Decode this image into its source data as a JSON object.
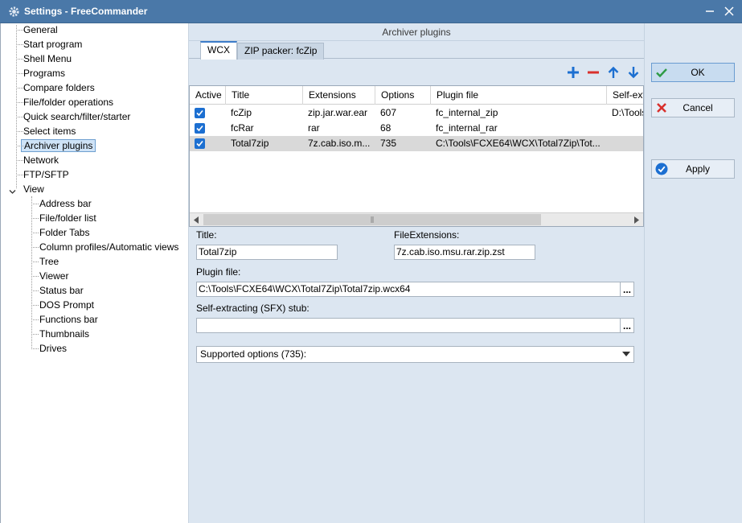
{
  "window": {
    "title": "Settings - FreeCommander"
  },
  "tree": {
    "items": [
      {
        "label": "General",
        "level": 1
      },
      {
        "label": "Start program",
        "level": 1
      },
      {
        "label": "Shell Menu",
        "level": 1
      },
      {
        "label": "Programs",
        "level": 1
      },
      {
        "label": "Compare folders",
        "level": 1
      },
      {
        "label": "File/folder operations",
        "level": 1
      },
      {
        "label": "Quick search/filter/starter",
        "level": 1
      },
      {
        "label": "Select items",
        "level": 1
      },
      {
        "label": "Archiver plugins",
        "level": 1,
        "selected": true
      },
      {
        "label": "Network",
        "level": 1
      },
      {
        "label": "FTP/SFTP",
        "level": 1
      },
      {
        "label": "View",
        "level": 1,
        "expanded": true
      },
      {
        "label": "Address bar",
        "level": 2
      },
      {
        "label": "File/folder list",
        "level": 2
      },
      {
        "label": "Folder Tabs",
        "level": 2
      },
      {
        "label": "Column profiles/Automatic views",
        "level": 2
      },
      {
        "label": "Tree",
        "level": 2
      },
      {
        "label": "Viewer",
        "level": 2
      },
      {
        "label": "Status bar",
        "level": 2
      },
      {
        "label": "DOS Prompt",
        "level": 2
      },
      {
        "label": "Functions bar",
        "level": 2
      },
      {
        "label": "Thumbnails",
        "level": 2
      },
      {
        "label": "Drives",
        "level": 2
      }
    ]
  },
  "main": {
    "section_title": "Archiver plugins",
    "tabs": [
      {
        "label": "WCX",
        "active": true
      },
      {
        "label": "ZIP packer: fcZip",
        "active": false
      }
    ],
    "toolbar": {
      "add_icon": "plus-icon",
      "remove_icon": "minus-icon",
      "up_icon": "arrow-up-icon",
      "down_icon": "arrow-down-icon",
      "accent_color": "#1c6fd1",
      "remove_color": "#d9302c"
    },
    "grid": {
      "columns": [
        "Active",
        "Title",
        "Extensions",
        "Options",
        "Plugin file",
        "Self-ext"
      ],
      "rows": [
        {
          "active": true,
          "title": "fcZip",
          "extensions": "zip.jar.war.ear",
          "options": "607",
          "plugin_file": "fc_internal_zip",
          "self_ext": "D:\\Tools",
          "selected": false
        },
        {
          "active": true,
          "title": "fcRar",
          "extensions": "rar",
          "options": "68",
          "plugin_file": "fc_internal_rar",
          "self_ext": "",
          "selected": false
        },
        {
          "active": true,
          "title": "Total7zip",
          "extensions": "7z.cab.iso.m...",
          "options": "735",
          "plugin_file": "C:\\Tools\\FCXE64\\WCX\\Total7Zip\\Tot...",
          "self_ext": "",
          "selected": true
        }
      ]
    },
    "form": {
      "title_label": "Title:",
      "title_value": "Total7zip",
      "ext_label": "FileExtensions:",
      "ext_value": "7z.cab.iso.msu.rar.zip.zst",
      "plugin_label": "Plugin file:",
      "plugin_value": "C:\\Tools\\FCXE64\\WCX\\Total7Zip\\Total7zip.wcx64",
      "sfx_label": "Self-extracting (SFX) stub:",
      "sfx_value": "",
      "browse_label": "...",
      "options_dropdown": "Supported options (735):"
    }
  },
  "buttons": {
    "ok": "OK",
    "cancel": "Cancel",
    "apply": "Apply"
  }
}
